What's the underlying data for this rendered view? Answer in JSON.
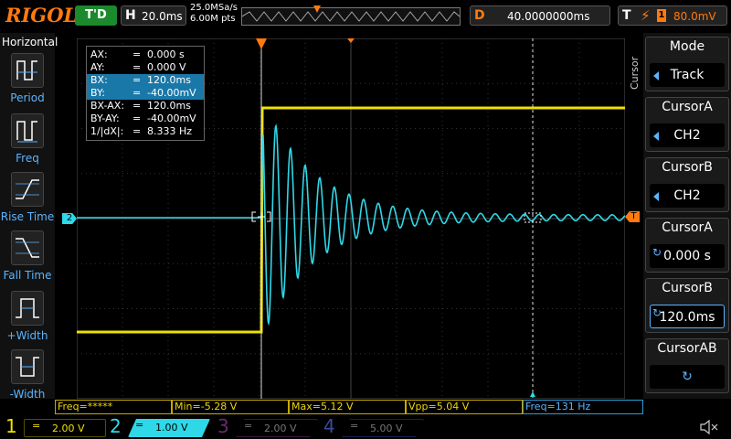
{
  "header": {
    "logo": "RIGOL",
    "trigger_state": "T'D",
    "horizontal_label": "H",
    "timebase": "20.0ms",
    "sample_rate": "25.0MSa/s",
    "memory_depth": "6.00M pts",
    "delay_label": "D",
    "delay_value": "40.0000000ms",
    "trigger_label": "T",
    "trigger_source": "1",
    "trigger_level": "80.0mV"
  },
  "left_panel": {
    "title": "Horizontal",
    "items": [
      {
        "label": "Period",
        "icon": "period-icon"
      },
      {
        "label": "Freq",
        "icon": "frequency-icon"
      },
      {
        "label": "Rise Time",
        "icon": "rise-time-icon"
      },
      {
        "label": "Fall Time",
        "icon": "fall-time-icon"
      },
      {
        "label": "+Width",
        "icon": "positive-width-icon"
      },
      {
        "label": "-Width",
        "icon": "negative-width-icon"
      }
    ]
  },
  "cursor_readout": [
    {
      "key": "AX:",
      "value": "0.000 s"
    },
    {
      "key": "AY:",
      "value": "0.000 V"
    },
    {
      "key": "BX:",
      "value": "120.0ms",
      "selected": true
    },
    {
      "key": "BY:",
      "value": "-40.00mV",
      "selected": true
    },
    {
      "key": "BX-AX:",
      "value": "120.0ms"
    },
    {
      "key": "BY-AY:",
      "value": "-40.00mV"
    },
    {
      "key": "1/|dX|:",
      "value": "8.333 Hz"
    }
  ],
  "cursor_readout_eq": "=",
  "markers": {
    "ch2_marker": "2",
    "trigger_marker": "T"
  },
  "right_menu": {
    "caption": "Cursor",
    "items": [
      {
        "title": "Mode",
        "value": "Track"
      },
      {
        "title": "CursorA",
        "value": "CH2"
      },
      {
        "title": "CursorB",
        "value": "CH2"
      },
      {
        "title": "CursorA",
        "value": "0.000 s"
      },
      {
        "title": "CursorB",
        "value": "120.0ms"
      },
      {
        "title": "CursorAB",
        "value": ""
      }
    ]
  },
  "measurements": {
    "freq": "Freq=*****",
    "min": "Min=-5.28 V",
    "max": "Max=5.12 V",
    "vpp": "Vpp=5.04 V",
    "freq2": "Freq=131 Hz"
  },
  "channels": [
    {
      "num": "1",
      "scale": "2.00 V",
      "color": "#f0e000",
      "active": false
    },
    {
      "num": "2",
      "scale": "1.00 V",
      "color": "#2fd8e8",
      "active": true
    },
    {
      "num": "3",
      "scale": "2.00 V",
      "color": "#d81ed8",
      "active": false
    },
    {
      "num": "4",
      "scale": "5.00 V",
      "color": "#3050e8",
      "active": false
    }
  ],
  "colors": {
    "ch1": "#f0e000",
    "ch2": "#2fd8e8",
    "accent": "#ff7a10",
    "menu_highlight": "#5ab4ff"
  }
}
